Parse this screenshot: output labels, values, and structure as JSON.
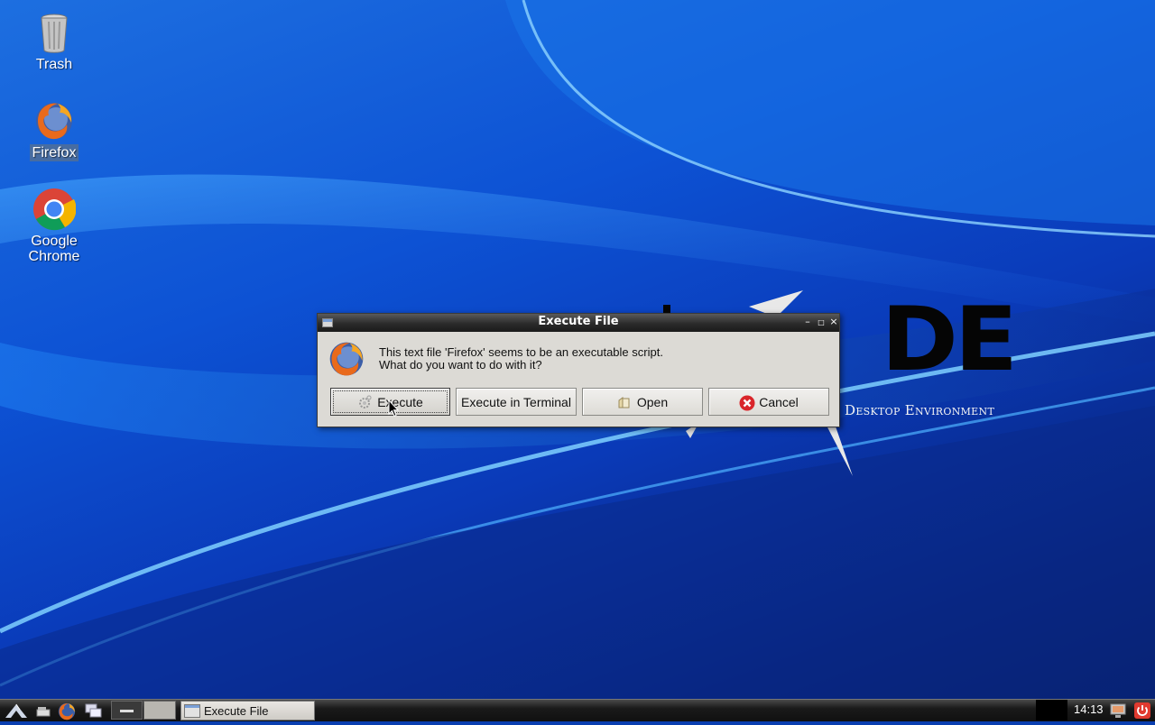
{
  "desktop": {
    "icons": [
      {
        "label": "Trash",
        "icon": "trash-icon",
        "selected": false
      },
      {
        "label": "Firefox",
        "icon": "firefox-icon",
        "selected": true
      },
      {
        "label": "Google Chrome",
        "icon": "chrome-icon",
        "selected": false
      }
    ],
    "wallpaper": {
      "logo_letters": "DE",
      "logo_subtitle": "Desktop Environment"
    }
  },
  "dialog": {
    "title": "Execute File",
    "message_line1": "This text file 'Firefox' seems to be an executable script.",
    "message_line2": "What do you want to do with it?",
    "buttons": {
      "execute": "Execute",
      "execute_in_terminal": "Execute in Terminal",
      "open": "Open",
      "cancel": "Cancel"
    },
    "focused_button": "execute"
  },
  "taskbar": {
    "task_button_label": "Execute File",
    "clock": "14:13"
  },
  "colors": {
    "titlebar": "#2b2b2b",
    "dialog_bg": "#dcdad5",
    "wallpaper_blue": "#0d52d4",
    "cancel_red": "#d9252a",
    "power_red": "#e03a2f"
  }
}
